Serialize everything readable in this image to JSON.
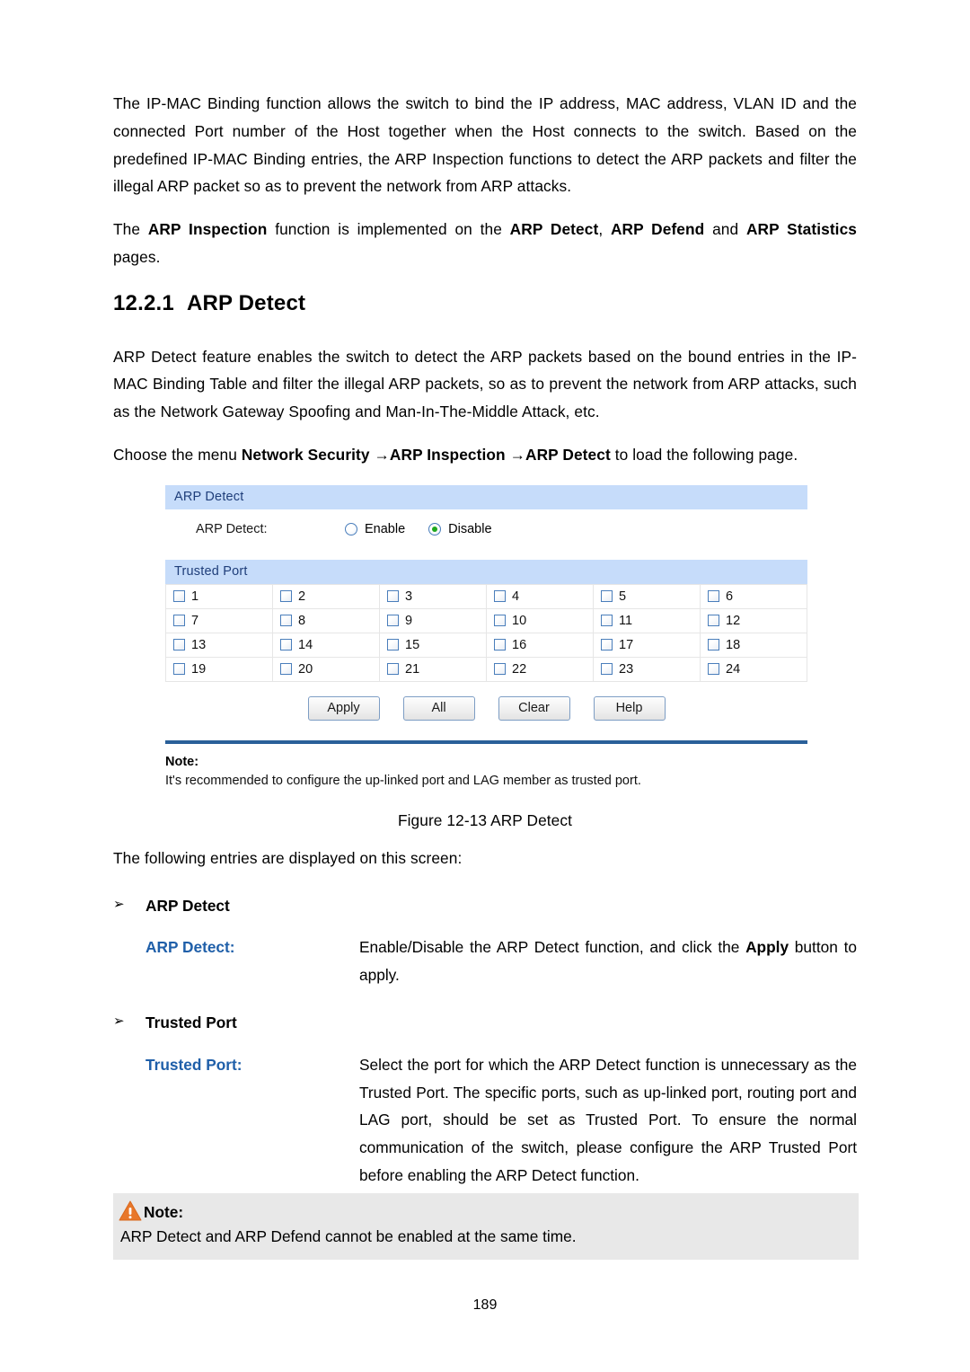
{
  "document": {
    "page_number": "189"
  },
  "intro": {
    "paragraph1_part1": "The IP-MAC Binding function allows the switch to bind the IP address, MAC address, VLAN ID and the connected Port number of the Host together when the Host connects to the switch. Based on the predefined IP-MAC Binding entries, the ARP Inspection functions to detect the ARP packets and filter the illegal ARP packet so as to prevent the network from ARP attacks.",
    "paragraph2": {
      "t1": "The ",
      "b1": "ARP Inspection",
      "t2": " function is implemented on the ",
      "b2": "ARP Detect",
      "t3": ", ",
      "b3": "ARP Defend",
      "t4": " and ",
      "b4": "ARP Statistics",
      "t5": " pages."
    }
  },
  "section": {
    "number": "12.2.1",
    "title": "ARP Detect",
    "paragraph1": "ARP Detect feature enables the switch to detect the ARP packets based on the bound entries in the IP-MAC Binding Table and filter the illegal ARP packets, so as to prevent the network from ARP attacks, such as the Network Gateway Spoofing and Man-In-The-Middle Attack, etc.",
    "paragraph2": {
      "t1": "Choose the menu ",
      "b1": "Network Security",
      "t2": " →",
      "b2": "ARP Inspection",
      "t3": " →",
      "b3": "ARP Detect",
      "t4": " to load the following page."
    }
  },
  "figure": {
    "caption": "Figure 12-13 ARP Detect",
    "arp_detect_panel": {
      "header": "ARP Detect",
      "field_label": "ARP Detect:",
      "options": [
        {
          "label": "Enable",
          "selected": false
        },
        {
          "label": "Disable",
          "selected": true
        }
      ]
    },
    "trusted_port_panel": {
      "header": "Trusted Port",
      "rows": [
        [
          "1",
          "2",
          "3",
          "4",
          "5",
          "6"
        ],
        [
          "7",
          "8",
          "9",
          "10",
          "11",
          "12"
        ],
        [
          "13",
          "14",
          "15",
          "16",
          "17",
          "18"
        ],
        [
          "19",
          "20",
          "21",
          "22",
          "23",
          "24"
        ]
      ],
      "checked_ports": []
    },
    "buttons": [
      {
        "label": "Apply"
      },
      {
        "label": "All"
      },
      {
        "label": "Clear"
      },
      {
        "label": "Help"
      }
    ],
    "note": {
      "title": "Note:",
      "text": "It's recommended to configure the up-linked port and LAG member as trusted port."
    },
    "colors": {
      "panel_header_bg": "#c6dcfa",
      "panel_header_text": "#1f3e7a",
      "rule": "#2a6099",
      "radio_border": "#4a7ebb",
      "radio_dot": "#1ea81e"
    }
  },
  "entries": {
    "lead_in": "The following entries are displayed on this screen:",
    "items": [
      {
        "bullet": "➢",
        "heading": "ARP Detect",
        "term": "ARP Detect:",
        "desc": {
          "t1": "Enable/Disable the ARP Detect function, and click the ",
          "b1": "Apply",
          "t2": " button to apply."
        }
      },
      {
        "bullet": "➢",
        "heading": "Trusted Port",
        "term": "Trusted Port:",
        "desc": {
          "t1": "Select the port for which the ARP Detect function is unnecessary as the Trusted Port. The specific ports, such as up-linked port, routing port and LAG port, should be set as Trusted Port. To ensure the normal communication of the switch, please configure the ARP Trusted Port before enabling the ARP Detect function.",
          "b1": "",
          "t2": ""
        }
      }
    ]
  },
  "callout": {
    "title": "Note:",
    "text": "ARP Detect and ARP Defend cannot be enabled at the same time.",
    "icon_color": "#e8772a"
  }
}
